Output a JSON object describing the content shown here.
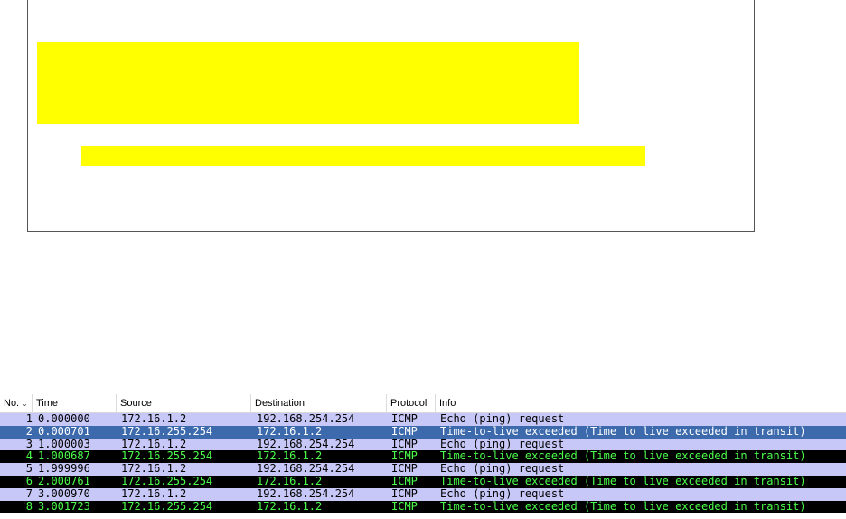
{
  "packet_list": {
    "columns": [
      {
        "key": "no",
        "label": "No."
      },
      {
        "key": "time",
        "label": "Time"
      },
      {
        "key": "source",
        "label": "Source"
      },
      {
        "key": "destination",
        "label": "Destination"
      },
      {
        "key": "protocol",
        "label": "Protocol"
      },
      {
        "key": "info",
        "label": "Info"
      }
    ],
    "sorted_column_icon": "sort-descending-icon",
    "rows": [
      {
        "no": "1",
        "time": "0.000000",
        "source": "172.16.1.2",
        "destination": "192.168.254.254",
        "protocol": "ICMP",
        "info": "Echo (ping) request"
      },
      {
        "no": "2",
        "time": "0.000701",
        "source": "172.16.255.254",
        "destination": "172.16.1.2",
        "protocol": "ICMP",
        "info": "Time-to-live exceeded (Time to live exceeded in transit)"
      },
      {
        "no": "3",
        "time": "1.000003",
        "source": "172.16.1.2",
        "destination": "192.168.254.254",
        "protocol": "ICMP",
        "info": "Echo (ping) request"
      },
      {
        "no": "4",
        "time": "1.000687",
        "source": "172.16.255.254",
        "destination": "172.16.1.2",
        "protocol": "ICMP",
        "info": "Time-to-live exceeded (Time to live exceeded in transit)"
      },
      {
        "no": "5",
        "time": "1.999996",
        "source": "172.16.1.2",
        "destination": "192.168.254.254",
        "protocol": "ICMP",
        "info": "Echo (ping) request"
      },
      {
        "no": "6",
        "time": "2.000761",
        "source": "172.16.255.254",
        "destination": "172.16.1.2",
        "protocol": "ICMP",
        "info": "Time-to-live exceeded (Time to live exceeded in transit)"
      },
      {
        "no": "7",
        "time": "3.000970",
        "source": "172.16.1.2",
        "destination": "192.168.254.254",
        "protocol": "ICMP",
        "info": "Echo (ping) request"
      },
      {
        "no": "8",
        "time": "3.001723",
        "source": "172.16.255.254",
        "destination": "172.16.1.2",
        "protocol": "ICMP",
        "info": "Time-to-live exceeded (Time to live exceeded in transit)"
      }
    ],
    "selected_row": "2"
  },
  "colors": {
    "highlight": "#ffff00",
    "echo_request_row": "#c8c8f8",
    "ttl_exceeded_row_bg": "#000000",
    "ttl_exceeded_row_fg": "#4cff4c",
    "selected_row_bg": "#3c6aad"
  }
}
